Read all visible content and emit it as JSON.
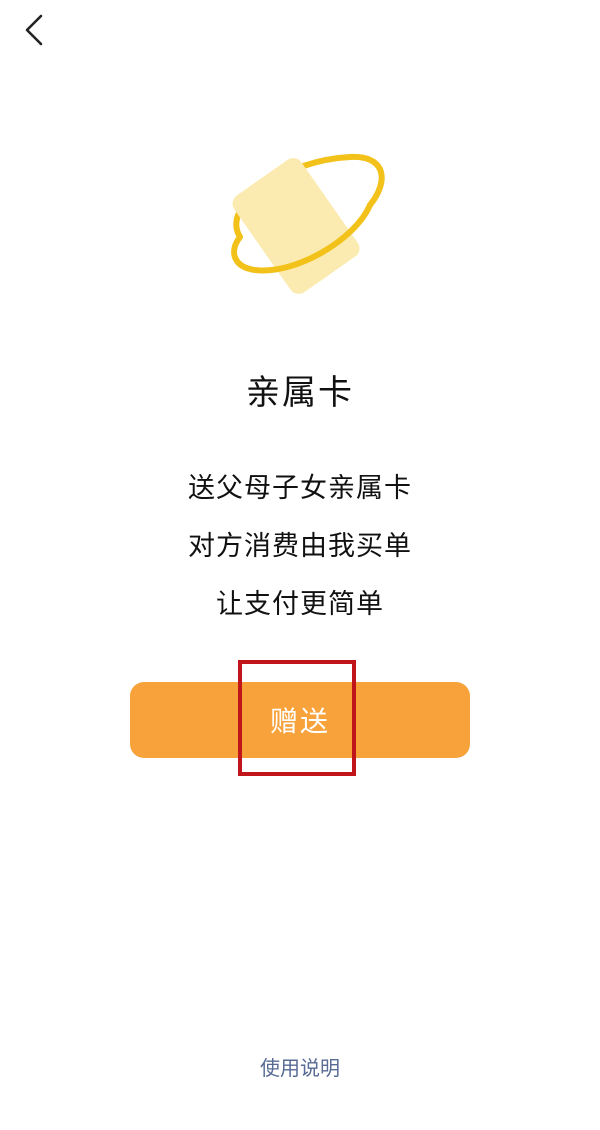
{
  "header": {
    "back_icon": "chevron-left-icon"
  },
  "hero": {
    "icon": "family-card-orbit-icon",
    "card_color": "#fcebb0",
    "ring_color": "#f2c21b"
  },
  "main": {
    "title": "亲属卡",
    "lines": [
      "送父母子女亲属卡",
      "对方消费由我买单",
      "让支付更简单"
    ]
  },
  "actions": {
    "gift_label": "赠送",
    "gift_color": "#f7a23b",
    "highlight_color": "#c0151a"
  },
  "footer": {
    "help_link": "使用说明",
    "link_color": "#576b95"
  }
}
